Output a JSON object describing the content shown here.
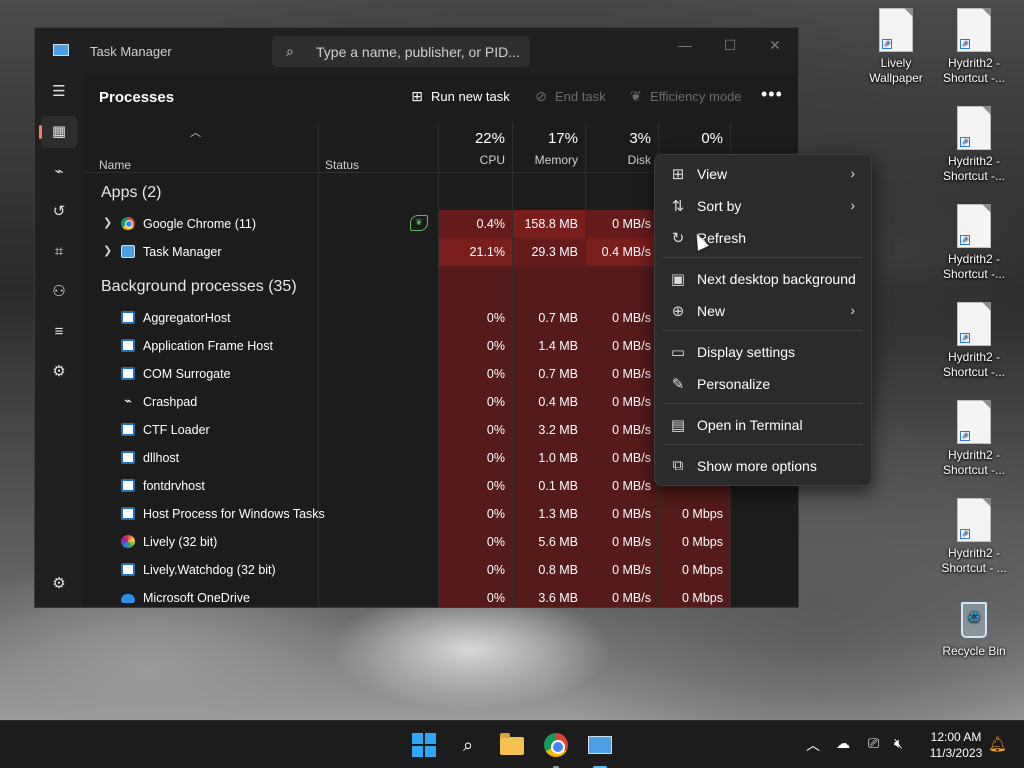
{
  "window": {
    "title": "Task Manager",
    "search_placeholder": "Type a name, publisher, or PID...",
    "controls": [
      "—",
      "☐",
      "✕"
    ]
  },
  "nav": {
    "icons": [
      "menu-icon",
      "processes-icon",
      "performance-icon",
      "app-history-icon",
      "startup-apps-icon",
      "users-icon",
      "details-icon",
      "services-icon",
      "settings-icon"
    ]
  },
  "commandbar": {
    "page_title": "Processes",
    "run_new_task": "Run new task",
    "end_task": "End task",
    "efficiency_mode": "Efficiency mode",
    "more": "•••"
  },
  "columns": {
    "name": "Name",
    "status": "Status",
    "cpu_pct": "22%",
    "cpu_label": "CPU",
    "memory_pct": "17%",
    "memory_label": "Memory",
    "disk_pct": "3%",
    "disk_label": "Disk",
    "network_pct": "0%"
  },
  "sections": {
    "apps": "Apps (2)",
    "background": "Background processes (35)"
  },
  "apps": [
    {
      "name": "Google Chrome (11)",
      "icon": "chrome-icon",
      "cpu": "0.4%",
      "memory": "158.8 MB",
      "disk": "0 MB/s",
      "network": ""
    },
    {
      "name": "Task Manager",
      "icon": "task-manager-icon",
      "cpu": "21.1%",
      "memory": "29.3 MB",
      "disk": "0.4 MB/s",
      "network": ""
    }
  ],
  "background": [
    {
      "name": "AggregatorHost",
      "icon": "window-icon",
      "cpu": "0%",
      "memory": "0.7 MB",
      "disk": "0 MB/s",
      "network": ""
    },
    {
      "name": "Application Frame Host",
      "icon": "window-icon",
      "cpu": "0%",
      "memory": "1.4 MB",
      "disk": "0 MB/s",
      "network": ""
    },
    {
      "name": "COM Surrogate",
      "icon": "window-icon",
      "cpu": "0%",
      "memory": "0.7 MB",
      "disk": "0 MB/s",
      "network": ""
    },
    {
      "name": "Crashpad",
      "icon": "pulse-icon",
      "cpu": "0%",
      "memory": "0.4 MB",
      "disk": "0 MB/s",
      "network": ""
    },
    {
      "name": "CTF Loader",
      "icon": "window-icon",
      "cpu": "0%",
      "memory": "3.2 MB",
      "disk": "0 MB/s",
      "network": ""
    },
    {
      "name": "dllhost",
      "icon": "window-icon",
      "cpu": "0%",
      "memory": "1.0 MB",
      "disk": "0 MB/s",
      "network": ""
    },
    {
      "name": "fontdrvhost",
      "icon": "window-icon",
      "cpu": "0%",
      "memory": "0.1 MB",
      "disk": "0 MB/s",
      "network": ""
    },
    {
      "name": "Host Process for Windows Tasks",
      "icon": "window-icon",
      "cpu": "0%",
      "memory": "1.3 MB",
      "disk": "0 MB/s",
      "network": "0 Mbps"
    },
    {
      "name": "Lively (32 bit)",
      "icon": "lively-icon",
      "cpu": "0%",
      "memory": "5.6 MB",
      "disk": "0 MB/s",
      "network": "0 Mbps"
    },
    {
      "name": "Lively.Watchdog (32 bit)",
      "icon": "window-icon",
      "cpu": "0%",
      "memory": "0.8 MB",
      "disk": "0 MB/s",
      "network": "0 Mbps"
    },
    {
      "name": "Microsoft OneDrive",
      "icon": "onedrive-icon",
      "cpu": "0%",
      "memory": "3.6 MB",
      "disk": "0 MB/s",
      "network": "0 Mbps"
    }
  ],
  "context_menu": {
    "items": [
      {
        "label": "View",
        "icon": "grid-icon",
        "submenu": true
      },
      {
        "label": "Sort by",
        "icon": "sort-icon",
        "submenu": true
      },
      {
        "label": "Refresh",
        "icon": "refresh-icon",
        "submenu": false
      },
      {
        "label": "Next desktop background",
        "icon": "wallpaper-icon",
        "submenu": false
      },
      {
        "label": "New",
        "icon": "new-icon",
        "submenu": true
      },
      {
        "label": "Display settings",
        "icon": "display-icon",
        "submenu": false
      },
      {
        "label": "Personalize",
        "icon": "brush-icon",
        "submenu": false
      },
      {
        "label": "Open in Terminal",
        "icon": "terminal-icon",
        "submenu": false
      },
      {
        "label": "Show more options",
        "icon": "more-options-icon",
        "submenu": false
      }
    ]
  },
  "desktop_icons": [
    {
      "label_1": "Lively",
      "label_2": "Wallpaper",
      "icon": "shortcut-file-icon"
    },
    {
      "label_1": "Hydrith2 -",
      "label_2": "Shortcut -...",
      "icon": "shortcut-file-icon"
    },
    {
      "label_1": "Hydrith2 -",
      "label_2": "Shortcut -...",
      "icon": "shortcut-file-icon"
    },
    {
      "label_1": "Hydrith2 -",
      "label_2": "Shortcut -...",
      "icon": "shortcut-file-icon"
    },
    {
      "label_1": "Hydrith2 -",
      "label_2": "Shortcut -...",
      "icon": "shortcut-file-icon"
    },
    {
      "label_1": "Hydrith2 -",
      "label_2": "Shortcut -...",
      "icon": "shortcut-file-icon"
    },
    {
      "label_1": "Hydrith2 -",
      "label_2": "Shortcut - ...",
      "icon": "shortcut-file-icon"
    },
    {
      "label_1": "Recycle Bin",
      "label_2": "",
      "icon": "recycle-bin-icon"
    }
  ],
  "taskbar": {
    "apps": [
      "start-icon",
      "search-icon",
      "file-explorer-icon",
      "chrome-icon",
      "task-manager-icon"
    ],
    "time": "12:00 AM",
    "date": "11/3/2023"
  },
  "colors": {
    "accent": "#ff7a66",
    "heat_low": "#551a1a",
    "heat_high": "#7a1d1d"
  }
}
